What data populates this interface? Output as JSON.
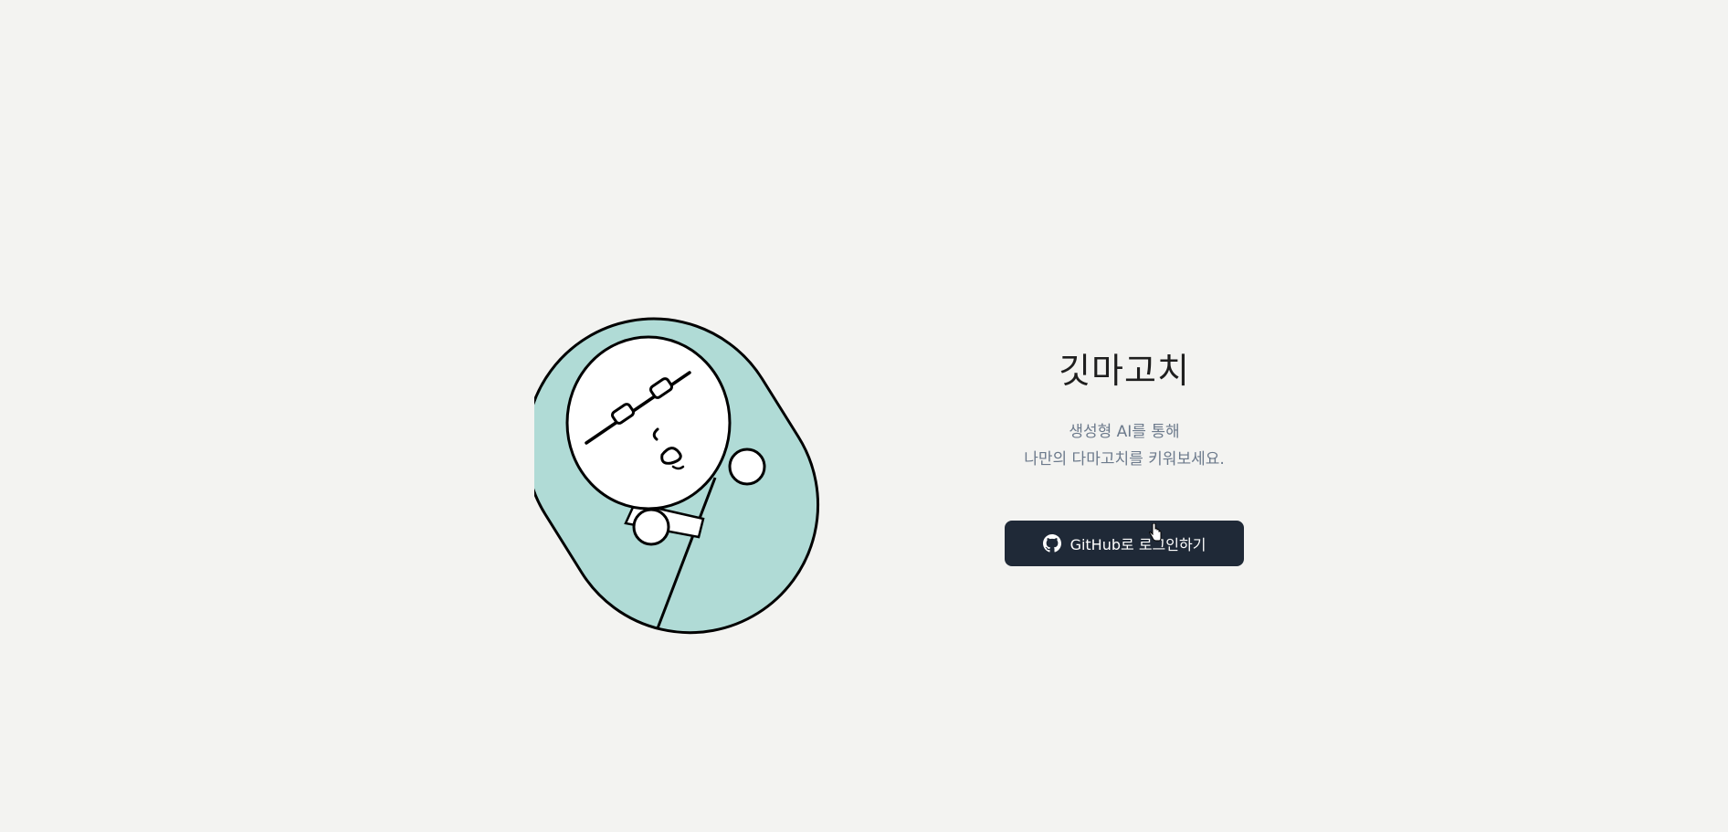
{
  "app": {
    "title": "깃마고치",
    "subtitle_line1": "생성형 AI를 통해",
    "subtitle_line2": "나만의 다마고치를 키워보세요."
  },
  "login": {
    "button_label": "GitHub로 로그인하기",
    "icon": "github-icon"
  },
  "colors": {
    "background": "#f3f3f1",
    "swaddle": "#b0dbd6",
    "button": "#1f2937",
    "subtitle": "#6c7a8c"
  }
}
